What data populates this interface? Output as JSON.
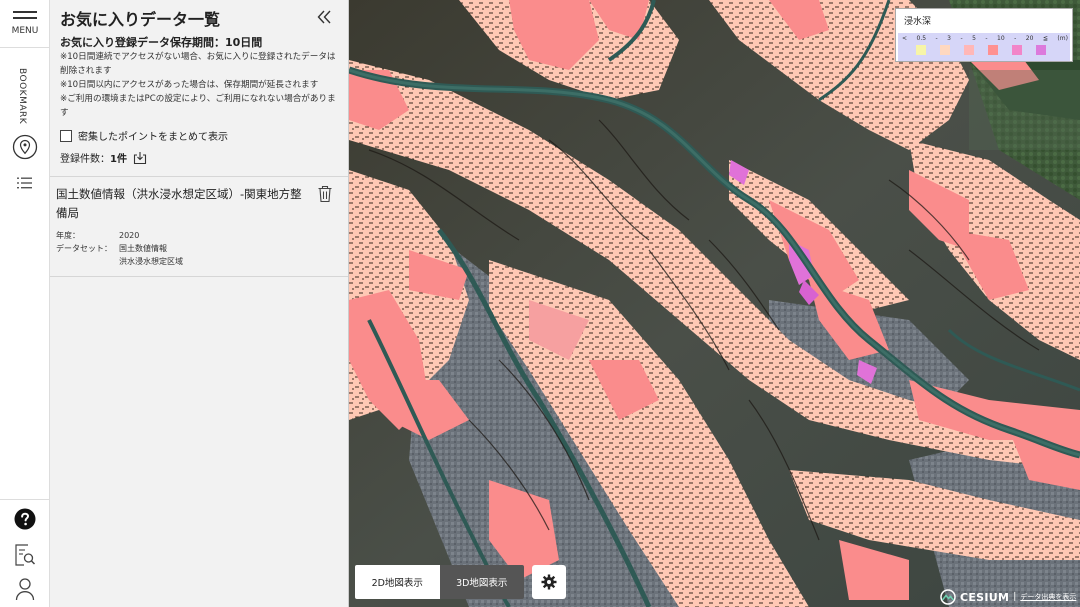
{
  "rail": {
    "menu_label": "MENU",
    "bookmark_label": "BOOKMARK"
  },
  "panel": {
    "title": "お気に入りデータ一覧",
    "period_title": "お気に入り登録データ保存期間：10日間",
    "notes": [
      "※10日間連続でアクセスがない場合、お気に入りに登録されたデータは削除されます",
      "※10日間以内にアクセスがあった場合は、保存期間が延長されます",
      "※ご利用の環境またはPCの設定により、ご利用になれない場合があります"
    ],
    "cluster_label": "密集したポイントをまとめて表示",
    "count_label": "登録件数：",
    "count_value": "1件",
    "items": [
      {
        "title": "国土数値情報（洪水浸水想定区域）-関東地方整備局",
        "year_key": "年度：",
        "year_value": "2020",
        "dataset_key": "データセット：",
        "dataset_value_1": "国土数値情報",
        "dataset_value_2": "洪水浸水想定区域"
      }
    ]
  },
  "legend": {
    "title": "浸水深",
    "ticks": [
      "<",
      "0.5",
      "-",
      "3",
      "-",
      "5",
      "-",
      "10",
      "-",
      "20",
      "≦",
      "(m)"
    ],
    "swatch_colors": [
      "#f7f5a8",
      "#ffd8c0",
      "#ffb7b7",
      "#ff9191",
      "#f285c9",
      "#dc7adc"
    ]
  },
  "controls": {
    "view_2d": "2D地図表示",
    "view_3d": "3D地図表示",
    "active_view": "3D"
  },
  "credit": {
    "logo_text": "CESIUM",
    "link_text": "データ出典を表示"
  },
  "colors": {
    "map_pink": "#ffc8b4",
    "map_red": "#fa8c8c",
    "map_magenta": "#e072d8"
  }
}
